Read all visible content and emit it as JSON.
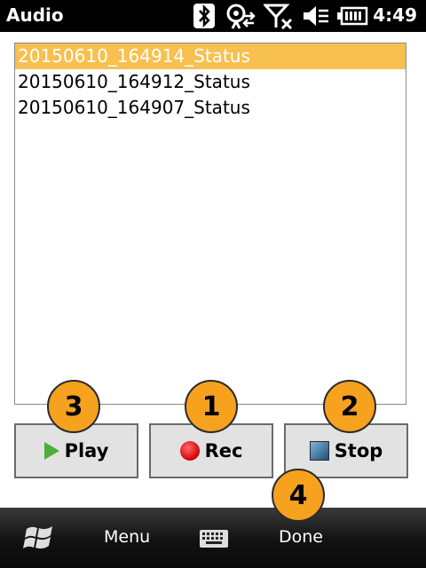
{
  "status_bar": {
    "app_title": "Audio",
    "time": "4:49",
    "icons": [
      "bluetooth-icon",
      "connectivity-icon",
      "signal-off-icon",
      "volume-muted-icon",
      "battery-icon"
    ]
  },
  "list": {
    "items": [
      {
        "label": "20150610_164914_Status",
        "selected": true
      },
      {
        "label": "20150610_164912_Status",
        "selected": false
      },
      {
        "label": "20150610_164907_Status",
        "selected": false
      }
    ]
  },
  "buttons": {
    "play_label": "Play",
    "rec_label": "Rec",
    "stop_label": "Stop"
  },
  "annotations": {
    "play": "3",
    "rec": "1",
    "stop": "2",
    "done": "4"
  },
  "bottom_bar": {
    "menu_label": "Menu",
    "done_label": "Done"
  },
  "colors": {
    "selection": "#f8c050",
    "badge": "#f6a21e"
  }
}
